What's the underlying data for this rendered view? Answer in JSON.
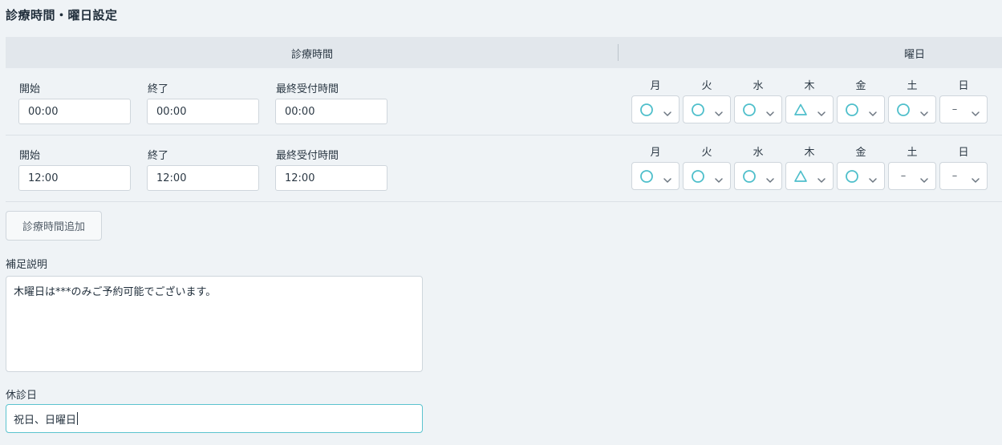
{
  "title": "診療時間・曜日設定",
  "header": {
    "time_label": "診療時間",
    "day_label": "曜日"
  },
  "columns": {
    "start": "開始",
    "end": "終了",
    "last_reception": "最終受付時間"
  },
  "days": [
    "月",
    "火",
    "水",
    "木",
    "金",
    "土",
    "日"
  ],
  "rows": [
    {
      "start": "00:00",
      "end": "00:00",
      "last": "00:00",
      "marks": [
        "circle",
        "circle",
        "circle",
        "triangle",
        "circle",
        "circle",
        "dash"
      ]
    },
    {
      "start": "12:00",
      "end": "12:00",
      "last": "12:00",
      "marks": [
        "circle",
        "circle",
        "circle",
        "triangle",
        "circle",
        "dash",
        "dash"
      ]
    }
  ],
  "mark_dash_text": "–",
  "add_button_label": "診療時間追加",
  "note": {
    "label": "補足説明",
    "value": "木曜日は***のみご予約可能でございます。"
  },
  "holiday": {
    "label": "休診日",
    "value": "祝日、日曜日"
  },
  "colors": {
    "accent": "#4fbfcb",
    "focus_border": "#5bc3cf"
  }
}
